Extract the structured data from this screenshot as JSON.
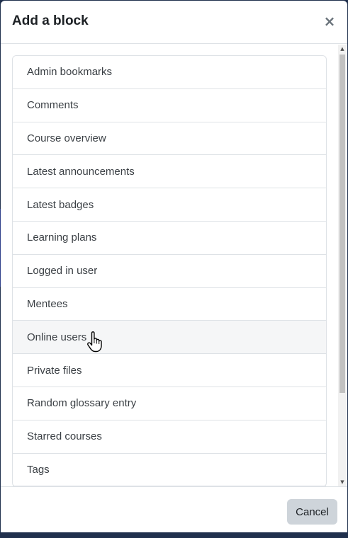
{
  "modal": {
    "title": "Add a block",
    "close_symbol": "×",
    "close_label": "Close",
    "cancel_label": "Cancel"
  },
  "blocks": [
    {
      "label": "Admin bookmarks"
    },
    {
      "label": "Comments"
    },
    {
      "label": "Course overview"
    },
    {
      "label": "Latest announcements"
    },
    {
      "label": "Latest badges"
    },
    {
      "label": "Learning plans"
    },
    {
      "label": "Logged in user"
    },
    {
      "label": "Mentees"
    },
    {
      "label": "Online users",
      "hovered": true
    },
    {
      "label": "Private files"
    },
    {
      "label": "Random glossary entry"
    },
    {
      "label": "Starred courses"
    },
    {
      "label": "Tags"
    }
  ],
  "scrollbar": {
    "up_icon": "triangle-up-icon",
    "down_icon": "triangle-down-icon"
  },
  "cursor": {
    "icon": "hand-pointer-icon"
  },
  "colors": {
    "modal_background": "#ffffff",
    "border": "#dee2e6",
    "hover_row": "#f5f6f7",
    "cancel_button": "#ced4da",
    "backdrop": "#20304d"
  }
}
